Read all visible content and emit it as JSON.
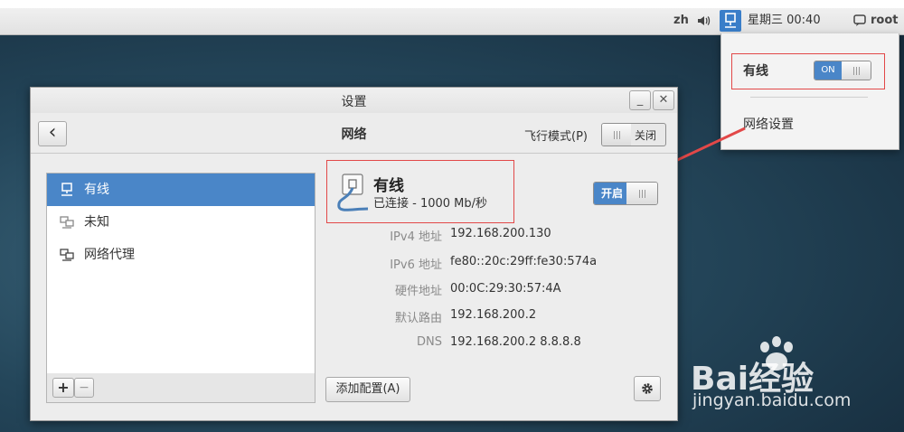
{
  "topbar": {
    "lang": "zh",
    "datetime": "星期三 00:40",
    "user": "root"
  },
  "popup": {
    "wired_label": "有线",
    "wired_switch": "ON",
    "network_settings": "网络设置"
  },
  "window": {
    "title": "设置",
    "minimize": "_",
    "close": "✕",
    "header": {
      "back": "‹",
      "title": "网络",
      "airplane_label": "飞行模式(P)",
      "airplane_switch": "关闭"
    },
    "sidebar": {
      "items": [
        {
          "label": "有线",
          "icon": "wired-icon"
        },
        {
          "label": "未知",
          "icon": "unknown-network-icon"
        },
        {
          "label": "网络代理",
          "icon": "proxy-icon"
        }
      ],
      "add": "+",
      "remove": "−"
    },
    "detail": {
      "name": "有线",
      "status": "已连接 - 1000 Mb/秒",
      "switch": "开启",
      "rows": [
        {
          "label": "IPv4 地址",
          "value": "192.168.200.130"
        },
        {
          "label": "IPv6 地址",
          "value": "fe80::20c:29ff:fe30:574a"
        },
        {
          "label": "硬件地址",
          "value": "00:0C:29:30:57:4A"
        },
        {
          "label": "默认路由",
          "value": "192.168.200.2"
        },
        {
          "label": "DNS",
          "value": "192.168.200.2 8.8.8.8"
        }
      ],
      "add_profile": "添加配置(A)"
    }
  },
  "watermark": {
    "brand": "Bai经验",
    "url": "jingyan.baidu.com"
  },
  "colors": {
    "accent": "#4a86c8",
    "annotation": "#e24848"
  }
}
